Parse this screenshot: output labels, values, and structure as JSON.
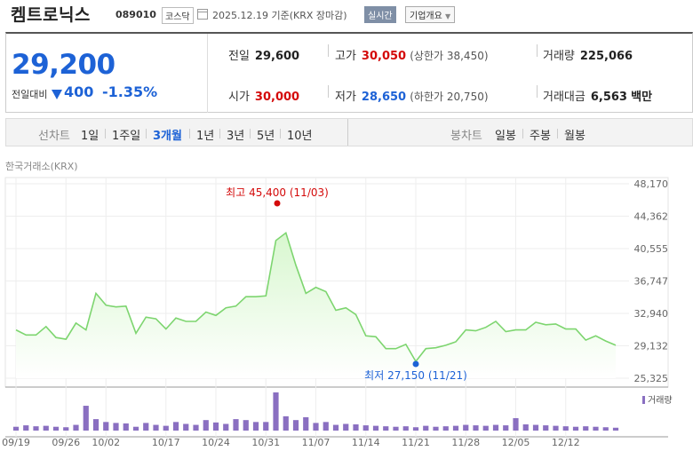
{
  "header": {
    "name": "켐트로닉스",
    "code": "089010",
    "market": "코스닥",
    "date": "2025.12.19 기준(KRX 장마감)",
    "realtime": "실시간",
    "company_info": "기업개요"
  },
  "summary": {
    "price": "29,200",
    "change_label": "전일대비",
    "change_value": "400",
    "change_pct": "-1.35%",
    "prev_close_label": "전일",
    "prev_close": "29,600",
    "high_label": "고가",
    "high": "30,050",
    "upper_limit": "(상한가 38,450)",
    "volume_label": "거래량",
    "volume": "225,066",
    "open_label": "시가",
    "open": "30,000",
    "low_label": "저가",
    "low": "28,650",
    "lower_limit": "(하한가 20,750)",
    "amount_label": "거래대금",
    "amount": "6,563",
    "amount_unit": "백만"
  },
  "tabs": {
    "line_label": "선차트",
    "line": [
      "1일",
      "1주일",
      "3개월",
      "1년",
      "3년",
      "5년",
      "10년"
    ],
    "candle_label": "봉차트",
    "candle": [
      "일봉",
      "주봉",
      "월봉"
    ]
  },
  "source": "한국거래소(KRX)",
  "colors": {
    "up": "#d40a0a",
    "down": "#1d62d6",
    "line": "#7dd56f",
    "area": "#d8f7cf",
    "volume": "#8a6fc1"
  },
  "chart_data": {
    "type": "area",
    "title": "",
    "xlabel": "",
    "ylabel": "",
    "ylim": [
      25325,
      48170
    ],
    "yticks": [
      "48,170",
      "44,362",
      "40,555",
      "36,747",
      "32,940",
      "29,132",
      "25,325"
    ],
    "xticks": [
      "09/19",
      "09/26",
      "10/02",
      "10/17",
      "10/24",
      "10/31",
      "11/07",
      "11/14",
      "11/21",
      "11/28",
      "12/05",
      "12/12"
    ],
    "x": [
      "09/19",
      "09/22",
      "09/23",
      "09/24",
      "09/25",
      "09/26",
      "09/29",
      "09/30",
      "10/01",
      "10/02",
      "10/10",
      "10/13",
      "10/14",
      "10/15",
      "10/16",
      "10/17",
      "10/20",
      "10/21",
      "10/22",
      "10/23",
      "10/24",
      "10/27",
      "10/28",
      "10/29",
      "10/30",
      "10/31",
      "11/03",
      "11/04",
      "11/05",
      "11/06",
      "11/07",
      "11/10",
      "11/11",
      "11/12",
      "11/13",
      "11/14",
      "11/17",
      "11/18",
      "11/19",
      "11/20",
      "11/21",
      "11/24",
      "11/25",
      "11/26",
      "11/27",
      "11/28",
      "12/01",
      "12/02",
      "12/03",
      "12/04",
      "12/05",
      "12/08",
      "12/09",
      "12/10",
      "12/11",
      "12/12",
      "12/15",
      "12/16",
      "12/17",
      "12/18",
      "12/19"
    ],
    "series": [
      {
        "values": [
          31000,
          30400,
          30400,
          31400,
          30100,
          29900,
          31800,
          31000,
          35300,
          33900,
          33700,
          33800,
          30600,
          32500,
          32300,
          31100,
          32400,
          32000,
          32000,
          33100,
          32700,
          33600,
          33800,
          34900,
          34900,
          35000,
          41500,
          42400,
          38600,
          35300,
          36000,
          35500,
          33300,
          33600,
          32800,
          30300,
          30200,
          28800,
          28800,
          29300,
          27300,
          28800,
          28900,
          29200,
          29600,
          31000,
          30900,
          31300,
          32000,
          30800,
          31000,
          31000,
          31900,
          31600,
          31700,
          31100,
          31100,
          29800,
          30300,
          29700,
          29200
        ]
      }
    ],
    "volume_label": "거래량",
    "volume": [
      40,
      55,
      45,
      50,
      40,
      35,
      60,
      260,
      120,
      90,
      80,
      75,
      40,
      80,
      60,
      50,
      90,
      70,
      60,
      110,
      85,
      70,
      120,
      110,
      90,
      90,
      400,
      150,
      110,
      140,
      80,
      90,
      60,
      70,
      65,
      55,
      50,
      45,
      40,
      45,
      35,
      50,
      40,
      45,
      50,
      60,
      55,
      50,
      60,
      55,
      130,
      65,
      60,
      55,
      50,
      45,
      40,
      45,
      40,
      35,
      30
    ],
    "annotations": {
      "high_label": "최고 45,400 (11/03)",
      "low_label": "최저 27,150 (11/21)"
    }
  }
}
